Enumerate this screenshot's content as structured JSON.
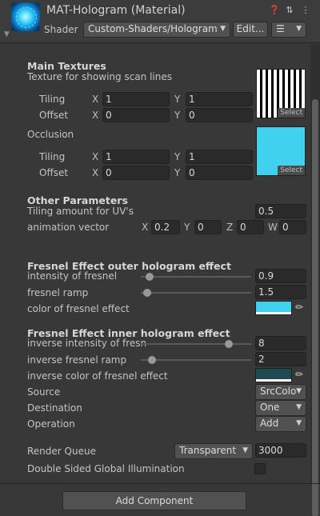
{
  "header": {
    "title": "MAT-Hologram (Material)",
    "shader_label": "Shader",
    "shader_value": "Custom-Shaders/Hologram",
    "edit_button": "Edit...",
    "list_icon": "list-icon",
    "icons": [
      "help-icon",
      "preset-icon",
      "more-menu-icon"
    ]
  },
  "main_textures": {
    "heading": "Main Textures",
    "scan_label": "Texture for showing scan lines",
    "tiling_label": "Tiling",
    "offset_label": "Offset",
    "scan_tiling": {
      "x": "1",
      "y": "1"
    },
    "scan_offset": {
      "x": "0",
      "y": "0"
    },
    "select_label": "Select",
    "occlusion_label": "Occlusion",
    "occ_tiling": {
      "x": "1",
      "y": "1"
    },
    "occ_offset": {
      "x": "0",
      "y": "0"
    }
  },
  "axis": {
    "x": "X",
    "y": "Y",
    "z": "Z",
    "w": "W"
  },
  "other": {
    "heading": "Other Parameters",
    "tiling_uv_label": "Tiling amount for UV's",
    "tiling_uv_value": "0.5",
    "anim_label": "animation vector",
    "anim": {
      "x": "0.2",
      "y": "0",
      "z": "0",
      "w": "0"
    }
  },
  "fresnel_outer": {
    "heading": "Fresnel Effect outer hologram effect",
    "intensity_label": "intensity of fresnel",
    "intensity_value": "0.9",
    "ramp_label": "fresnel ramp",
    "ramp_value": "1.5",
    "color_label": "color of fresnel effect",
    "color": "#3fd1ee"
  },
  "fresnel_inner": {
    "heading": "Fresnel Effect inner hologram effect",
    "intensity_label": "inverse intensity of fresn",
    "intensity_value": "8",
    "ramp_label": "inverse fresnel ramp",
    "ramp_value": "2",
    "color_label": "inverse color of fresnel effect",
    "color": "#1f4a52"
  },
  "blend": {
    "source_label": "Source",
    "source_value": "SrcColo",
    "destination_label": "Destination",
    "destination_value": "One",
    "operation_label": "Operation",
    "operation_value": "Add"
  },
  "render": {
    "queue_label": "Render Queue",
    "queue_mode": "Transparent",
    "queue_value": "3000",
    "dsgi_label": "Double Sided Global Illumination",
    "dsgi_checked": false
  },
  "sliders": {
    "outer_intensity": 0.08,
    "outer_ramp": 0.06,
    "inner_intensity": 0.8,
    "inner_ramp": 0.1
  },
  "footer": {
    "add_component": "Add Component"
  }
}
